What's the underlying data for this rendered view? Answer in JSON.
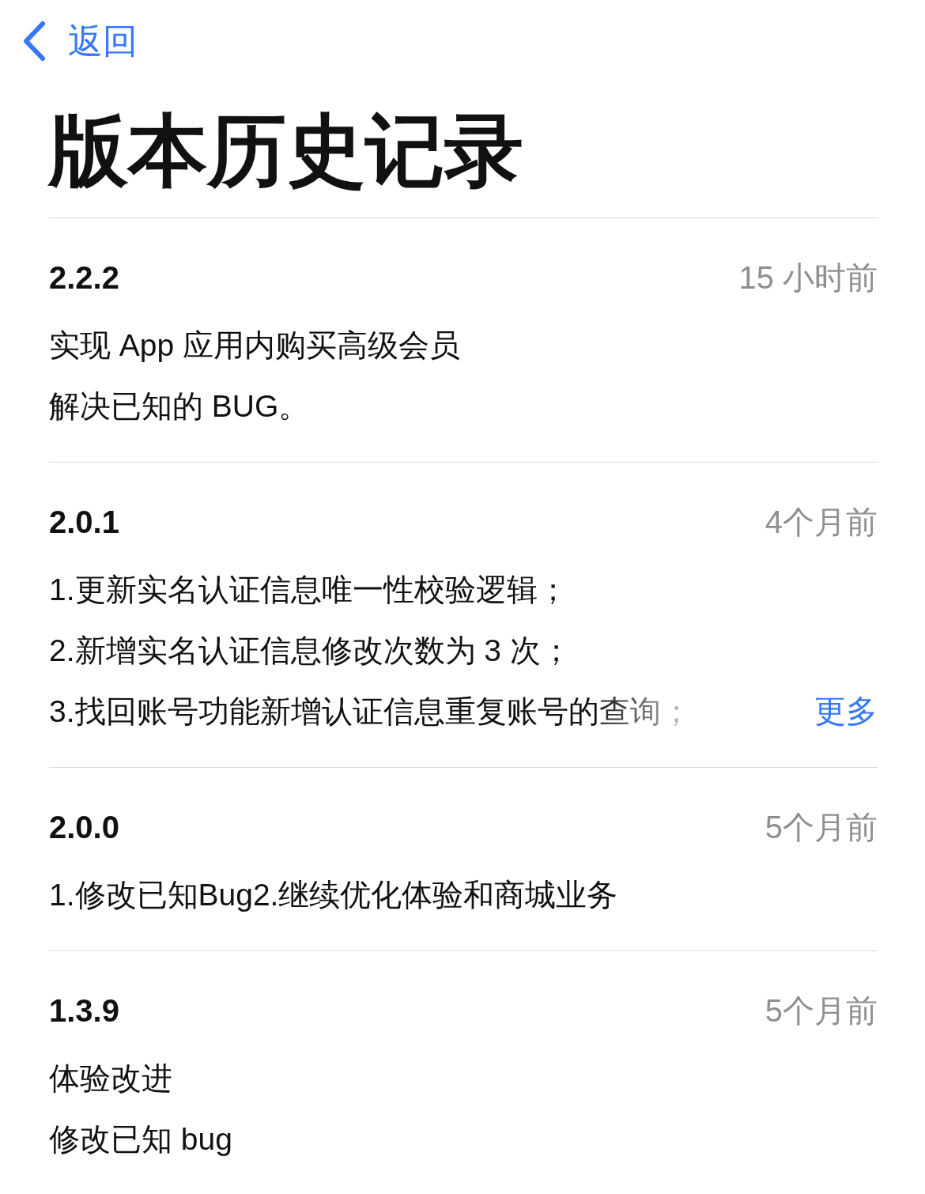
{
  "nav": {
    "back": "返回"
  },
  "title": "版本历史记录",
  "versions": [
    {
      "version": "2.2.2",
      "date": "15 小时前",
      "notes": [
        "实现 App 应用内购买高级会员",
        "解决已知的 BUG。"
      ]
    },
    {
      "version": "2.0.1",
      "date": "4个月前",
      "notes": [
        "1.更新实名认证信息唯一性校验逻辑；",
        "2.新增实名认证信息修改次数为 3 次；",
        "3.找回账号功能新增认证信息重复账号的查询；"
      ],
      "more": "更多"
    },
    {
      "version": "2.0.0",
      "date": "5个月前",
      "notes": [
        "1.修改已知Bug2.继续优化体验和商城业务"
      ]
    },
    {
      "version": "1.3.9",
      "date": "5个月前",
      "notes": [
        "体验改进",
        "修改已知 bug"
      ]
    }
  ]
}
